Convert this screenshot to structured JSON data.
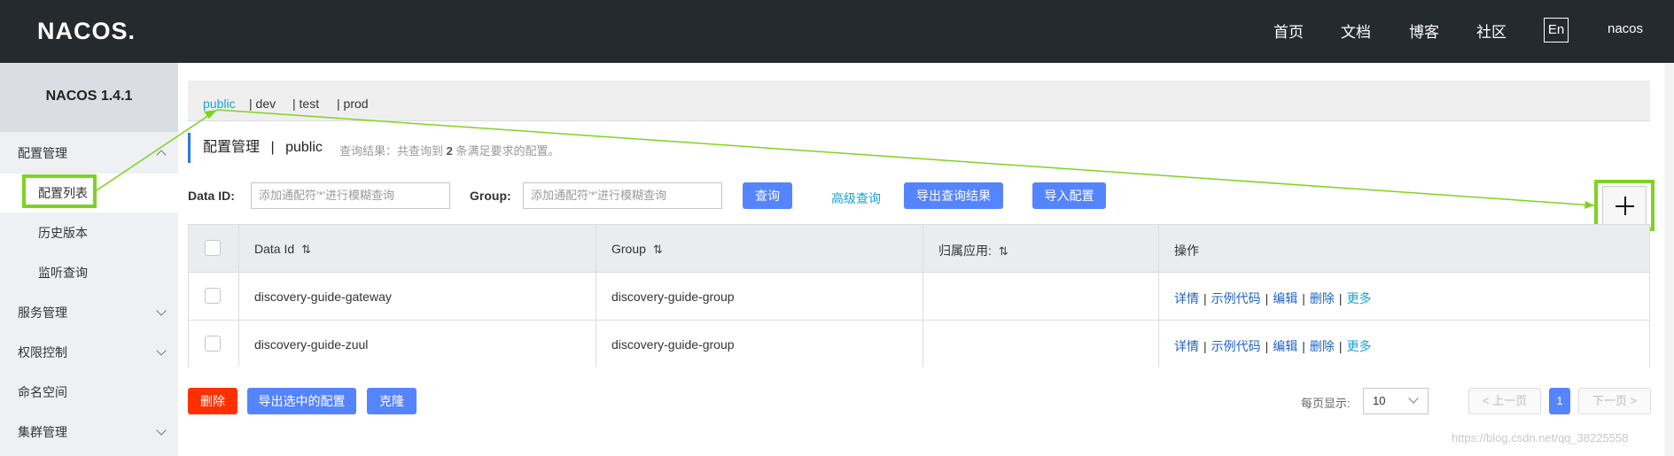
{
  "header": {
    "logo": "NACOS.",
    "nav": [
      "首页",
      "文档",
      "博客",
      "社区"
    ],
    "lang": "En",
    "user": "nacos"
  },
  "sidebar": {
    "version": "NACOS 1.4.1",
    "items": [
      {
        "label": "配置管理",
        "expanded": true
      },
      {
        "label": "配置列表",
        "active": true
      },
      {
        "label": "历史版本"
      },
      {
        "label": "监听查询"
      },
      {
        "label": "服务管理"
      },
      {
        "label": "权限控制"
      },
      {
        "label": "命名空间"
      },
      {
        "label": "集群管理"
      }
    ]
  },
  "namespaces": [
    "public",
    "| dev",
    "| test",
    "| prod"
  ],
  "page": {
    "title": "配置管理",
    "sep": "|",
    "namespace": "public",
    "result_prefix": "查询结果：共查询到",
    "result_count": "2",
    "result_suffix": "条满足要求的配置。"
  },
  "search": {
    "dataid_label": "Data ID:",
    "dataid_placeholder": "添加通配符'*'进行模糊查询",
    "group_label": "Group:",
    "group_placeholder": "添加通配符'*'进行模糊查询",
    "query_button": "查询",
    "advanced_link": "高级查询",
    "export_button": "导出查询结果",
    "import_button": "导入配置"
  },
  "table": {
    "columns": [
      "Data Id",
      "Group",
      "归属应用:",
      "操作"
    ],
    "rows": [
      {
        "data_id": "discovery-guide-gateway",
        "group": "discovery-guide-group",
        "app": ""
      },
      {
        "data_id": "discovery-guide-zuul",
        "group": "discovery-guide-group",
        "app": ""
      }
    ],
    "actions": [
      "详情",
      "示例代码",
      "编辑",
      "删除",
      "更多"
    ],
    "action_sep": "|"
  },
  "bottom": {
    "delete_button": "删除",
    "export_selected_button": "导出选中的配置",
    "clone_button": "克隆"
  },
  "pager": {
    "page_size_label": "每页显示:",
    "page_size": "10",
    "prev": "上一页",
    "current": "1",
    "next": "下一页"
  },
  "watermark": "https://blog.csdn.net/qq_38225558",
  "colors": {
    "header_bg": "#252a2f",
    "primary": "#5584ff",
    "danger": "#ff3000",
    "link": "#17a2d6",
    "annotation": "#7ed321"
  },
  "icons": {
    "add": "plus-icon",
    "sort": "sort-icon",
    "expand": "chevron-icon"
  }
}
